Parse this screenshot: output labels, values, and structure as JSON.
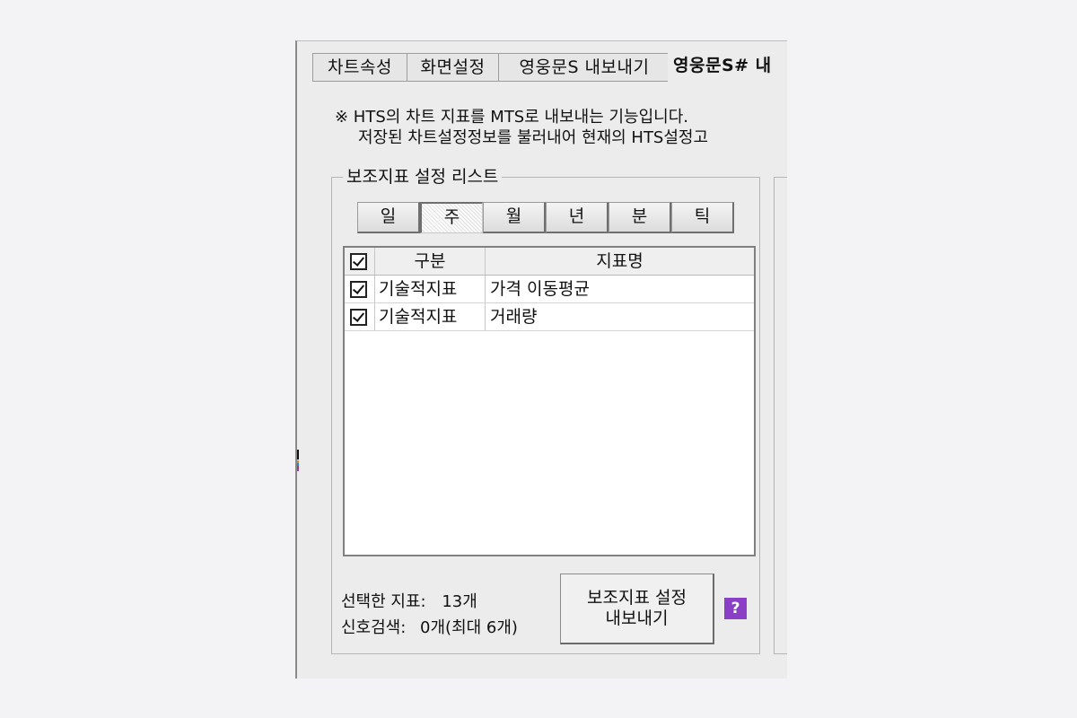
{
  "tabs": [
    {
      "label": "차트속성"
    },
    {
      "label": "화면설정"
    },
    {
      "label": "영웅문S 내보내기"
    },
    {
      "label": "영웅문S# 내"
    }
  ],
  "notice": {
    "line1": "※ HTS의 차트 지표를 MTS로 내보내는 기능입니다.",
    "line2": "저장된 차트설정정보를 불러내어 현재의 HTS설정고"
  },
  "group": {
    "title": "보조지표 설정 리스트",
    "periods": [
      "일",
      "주",
      "월",
      "년",
      "분",
      "틱"
    ],
    "selected_period": "주"
  },
  "table": {
    "columns": [
      "구분",
      "지표명"
    ],
    "header_checked": true,
    "rows": [
      {
        "checked": true,
        "type": "기술적지표",
        "name": "가격 이동평균"
      },
      {
        "checked": true,
        "type": "기술적지표",
        "name": "거래량"
      }
    ]
  },
  "stats": {
    "selected_label": "선택한 지표:",
    "selected_value": "13개",
    "signal_label": "신호검색:",
    "signal_value": "0개(최대 6개)"
  },
  "export_button": {
    "line1": "보조지표 설정",
    "line2": "내보내기"
  },
  "help": {
    "glyph": "?"
  },
  "colors": {
    "help_icon": "#8b3fc6",
    "background": "#ececec"
  }
}
